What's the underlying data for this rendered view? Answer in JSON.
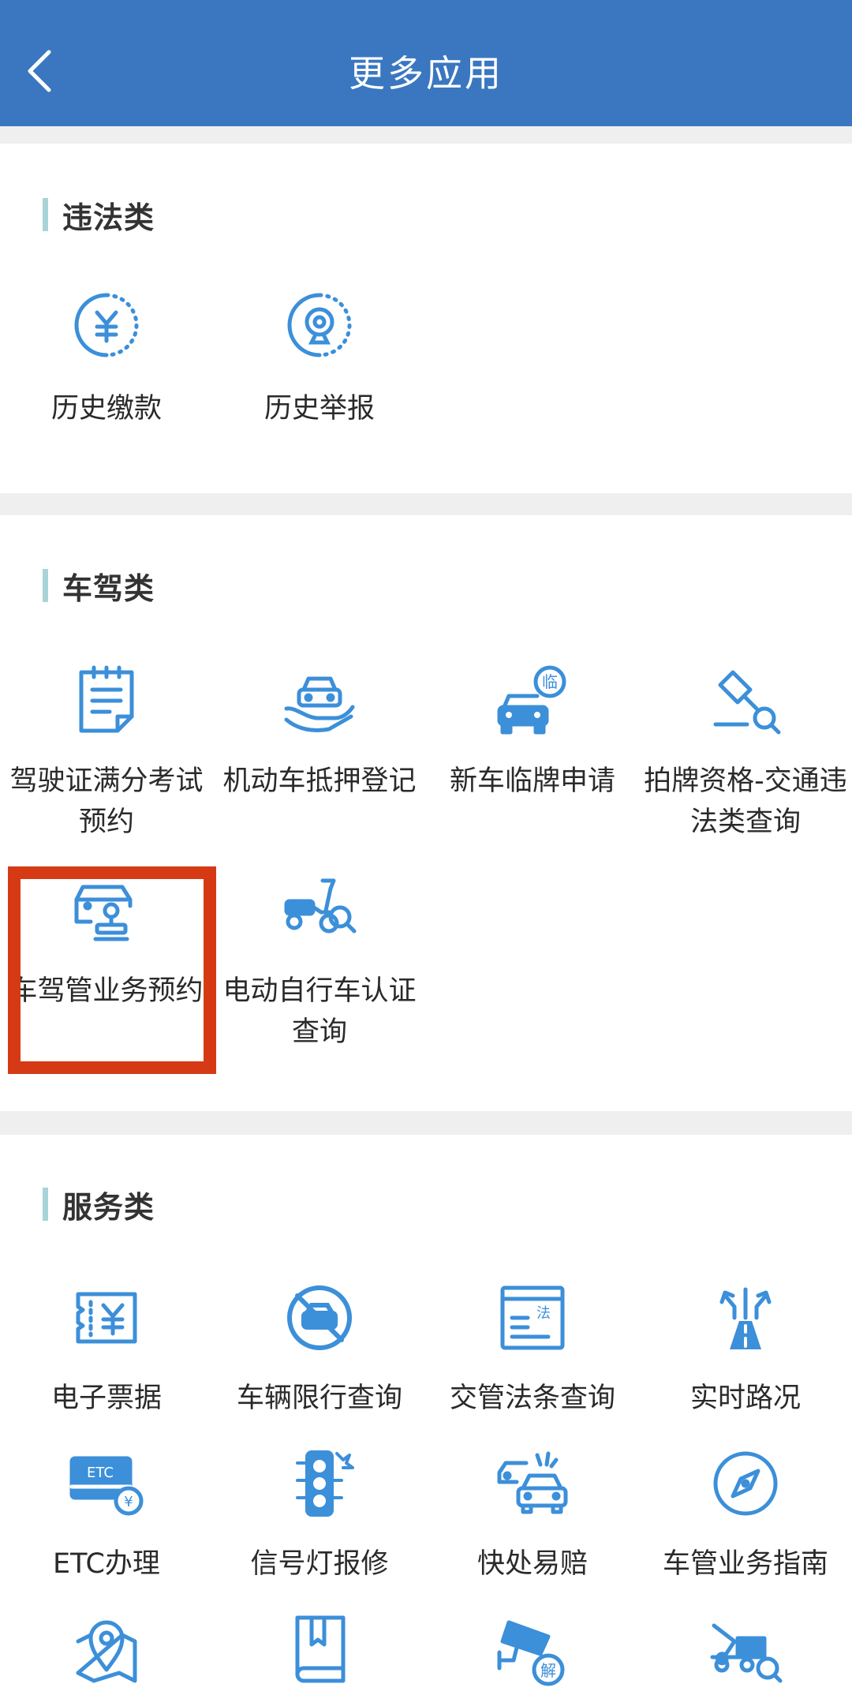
{
  "header": {
    "title": "更多应用"
  },
  "sections": [
    {
      "title": "违法类",
      "items": [
        {
          "label": "历史缴款",
          "icon": "yuan-coin-icon"
        },
        {
          "label": "历史举报",
          "icon": "camera-report-icon"
        }
      ]
    },
    {
      "title": "车驾类",
      "items": [
        {
          "label": "驾驶证满分考试预约",
          "icon": "clipboard-icon"
        },
        {
          "label": "机动车抵押登记",
          "icon": "car-in-hand-icon"
        },
        {
          "label": "新车临牌申请",
          "icon": "temporary-plate-car-icon"
        },
        {
          "label": "拍牌资格-交通违法类查询",
          "icon": "gavel-search-icon"
        },
        {
          "label": "车驾管业务预约",
          "icon": "car-stamp-icon"
        },
        {
          "label": "电动自行车认证查询",
          "icon": "scooter-search-icon"
        }
      ]
    },
    {
      "title": "服务类",
      "items": [
        {
          "label": "电子票据",
          "icon": "yuan-receipt-icon"
        },
        {
          "label": "车辆限行查询",
          "icon": "no-car-icon"
        },
        {
          "label": "交管法条查询",
          "icon": "law-document-icon"
        },
        {
          "label": "实时路况",
          "icon": "road-arrows-icon"
        },
        {
          "label": "ETC办理",
          "icon": "etc-card-icon"
        },
        {
          "label": "信号灯报修",
          "icon": "traffic-light-icon"
        },
        {
          "label": "快处易赔",
          "icon": "car-collision-icon"
        },
        {
          "label": "车管业务指南",
          "icon": "compass-icon"
        },
        {
          "label": "",
          "icon": "map-pin-icon"
        },
        {
          "label": "",
          "icon": "book-icon"
        },
        {
          "label": "",
          "icon": "camera-unlock-icon"
        },
        {
          "label": "",
          "icon": "tow-truck-search-icon"
        }
      ]
    }
  ],
  "colors": {
    "header_bg": "#3a77c0",
    "icon_blue": "#3c8fd9",
    "highlight": "#d63a14",
    "section_bar": "#a8d4d8",
    "divider": "#efefef"
  }
}
